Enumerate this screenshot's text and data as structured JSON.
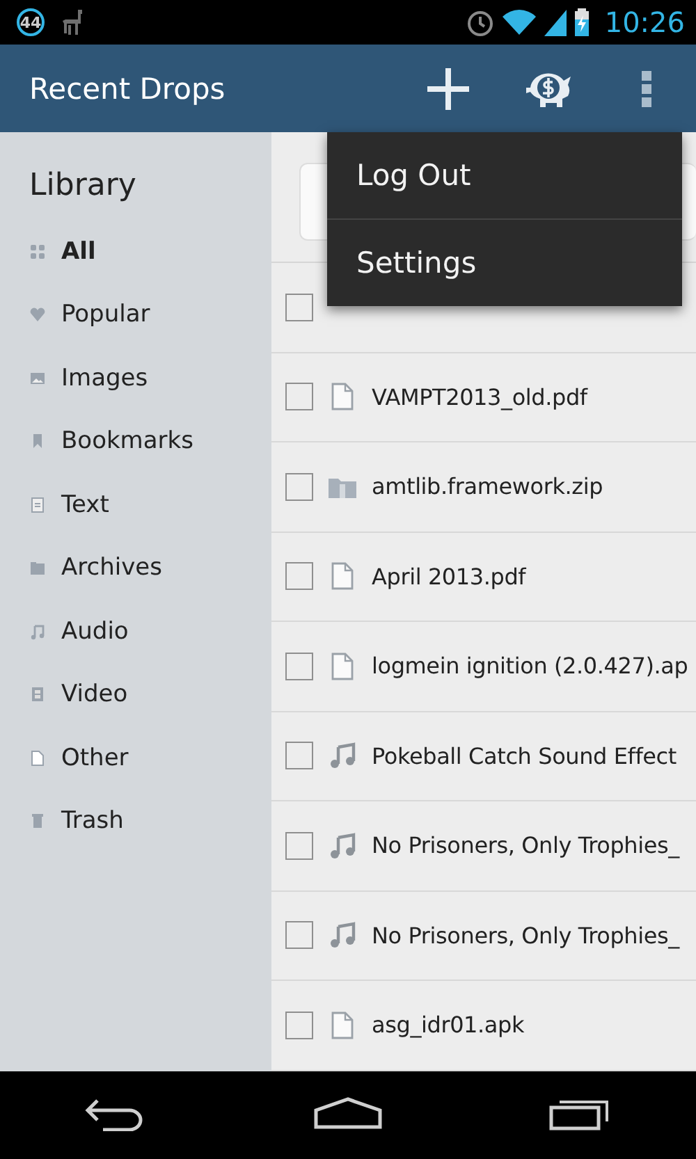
{
  "status_bar": {
    "notification_count": "44",
    "time": "10:26"
  },
  "action_bar": {
    "title": "Recent Drops"
  },
  "overflow_menu": {
    "items": [
      "Log Out",
      "Settings"
    ]
  },
  "sidebar": {
    "title": "Library",
    "items": [
      {
        "label": "All",
        "kind": "grid",
        "selected": true
      },
      {
        "label": "Popular",
        "kind": "heart",
        "selected": false
      },
      {
        "label": "Images",
        "kind": "image",
        "selected": false
      },
      {
        "label": "Bookmarks",
        "kind": "bookmark",
        "selected": false
      },
      {
        "label": "Text",
        "kind": "text",
        "selected": false
      },
      {
        "label": "Archives",
        "kind": "archive",
        "selected": false
      },
      {
        "label": "Audio",
        "kind": "audio",
        "selected": false
      },
      {
        "label": "Video",
        "kind": "video",
        "selected": false
      },
      {
        "label": "Other",
        "kind": "other",
        "selected": false
      },
      {
        "label": "Trash",
        "kind": "trash",
        "selected": false
      }
    ]
  },
  "files": [
    {
      "checked": false
    },
    {
      "name": "VAMPT2013_old.pdf",
      "kind": "document",
      "checked": false
    },
    {
      "name": "amtlib.framework.zip",
      "kind": "archive",
      "checked": false
    },
    {
      "name": "April 2013.pdf",
      "kind": "document",
      "checked": false
    },
    {
      "name": "logmein ignition (2.0.427).ap",
      "kind": "document",
      "checked": false
    },
    {
      "name": "Pokeball Catch Sound Effect",
      "kind": "audio",
      "checked": false
    },
    {
      "name": "No Prisoners, Only Trophies_",
      "kind": "audio",
      "checked": false
    },
    {
      "name": "No Prisoners, Only Trophies_",
      "kind": "audio",
      "checked": false
    },
    {
      "name": "asg_idr01.apk",
      "kind": "document",
      "checked": false
    }
  ]
}
